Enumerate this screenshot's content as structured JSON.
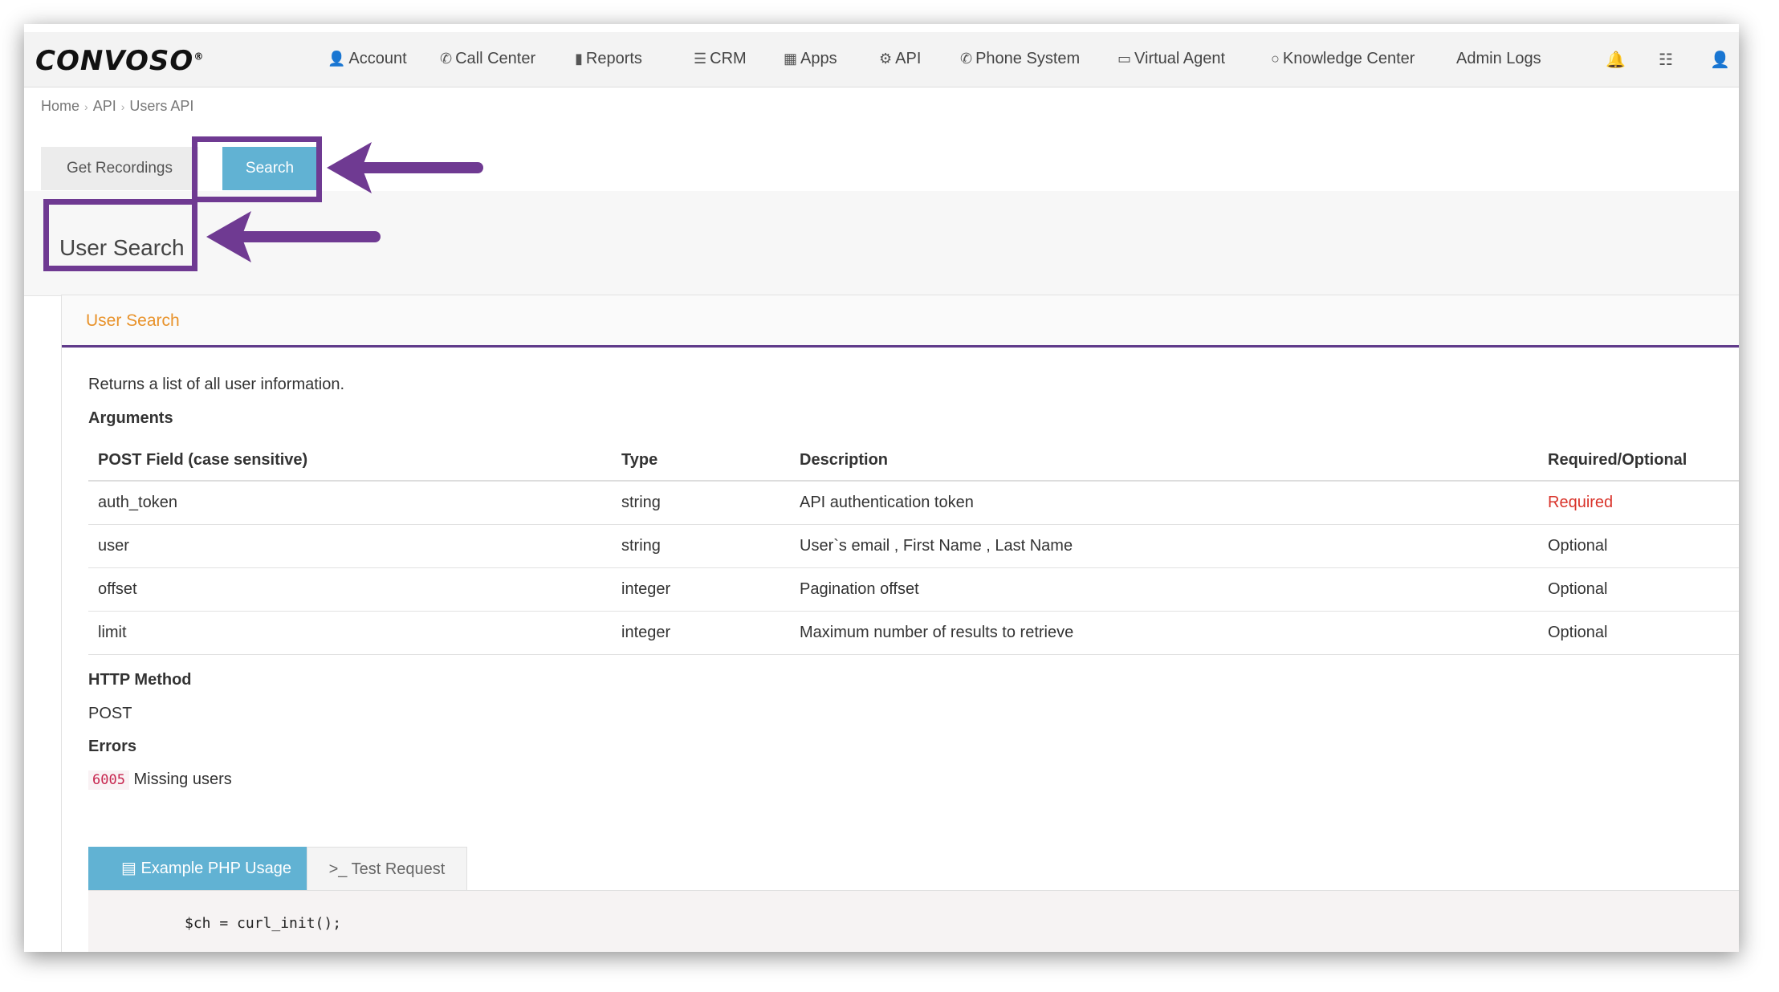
{
  "header": {
    "logo": "CONVOSO",
    "nav": [
      {
        "icon": "user-icon",
        "label": "Account"
      },
      {
        "icon": "phone-icon",
        "label": "Call Center"
      },
      {
        "icon": "bar-chart-icon",
        "label": "Reports"
      },
      {
        "icon": "list-icon",
        "label": "CRM"
      },
      {
        "icon": "grid-icon",
        "label": "Apps"
      },
      {
        "icon": "gear-icon",
        "label": "API"
      },
      {
        "icon": "phone-icon",
        "label": "Phone System"
      },
      {
        "icon": "monitor-icon",
        "label": "Virtual Agent"
      },
      {
        "icon": "lightbulb-icon",
        "label": "Knowledge Center"
      },
      {
        "icon": "",
        "label": "Admin Logs"
      }
    ],
    "right_icons": [
      "bell-icon",
      "database-icon",
      "user-icon"
    ]
  },
  "breadcrumb": [
    "Home",
    "API",
    "Users API"
  ],
  "tabs": [
    {
      "label": "Get Recordings",
      "active": false
    },
    {
      "label": "Search",
      "active": true
    }
  ],
  "page_title": "User Search",
  "panel": {
    "title": "User Search",
    "description": "Returns a list of all user information.",
    "arguments_heading": "Arguments",
    "columns": [
      "POST Field (case sensitive)",
      "Type",
      "Description",
      "Required/Optional"
    ],
    "rows": [
      {
        "field": "auth_token",
        "type": "string",
        "description": "API authentication token",
        "required": "Required"
      },
      {
        "field": "user",
        "type": "string",
        "description": "User`s email , First Name , Last Name",
        "required": "Optional"
      },
      {
        "field": "offset",
        "type": "integer",
        "description": "Pagination offset",
        "required": "Optional"
      },
      {
        "field": "limit",
        "type": "integer",
        "description": "Maximum number of results to retrieve",
        "required": "Optional"
      }
    ],
    "http_method_heading": "HTTP Method",
    "http_method": "POST",
    "errors_heading": "Errors",
    "error_code": "6005",
    "error_text": "Missing users"
  },
  "example_tabs": [
    {
      "icon": "file-code-icon",
      "label": "Example PHP Usage",
      "active": true
    },
    {
      "icon": "terminal-icon",
      "label": "Test Request",
      "active": false
    }
  ],
  "code": "$ch = curl_init();",
  "colors": {
    "accent": "#61b2d3",
    "highlight": "#6f3a92",
    "panel_title": "#e8922a",
    "required": "#d9342b"
  }
}
